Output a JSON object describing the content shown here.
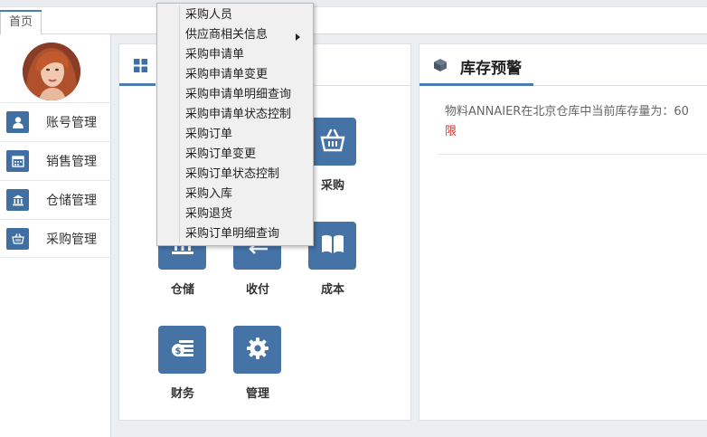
{
  "tabs": [
    {
      "label": "首页"
    }
  ],
  "sidebar": {
    "items": [
      {
        "label": "账号管理",
        "icon": "user-icon"
      },
      {
        "label": "销售管理",
        "icon": "calendar-icon"
      },
      {
        "label": "仓储管理",
        "icon": "bank-icon"
      },
      {
        "label": "采购管理",
        "icon": "basket-icon"
      }
    ]
  },
  "modules": {
    "purchase": "采购",
    "warehouse": "仓储",
    "payment": "收付",
    "cost": "成本",
    "finance": "财务",
    "manage": "管理"
  },
  "inventory": {
    "title": "库存预警",
    "message": "物料ANNAIER在北京仓库中当前库存量为：60",
    "message_tail": "限"
  },
  "context_menu": {
    "items": [
      "采购人员",
      "供应商相关信息",
      "采购申请单",
      "采购申请单变更",
      "采购申请单明细查询",
      "采购申请单状态控制",
      "采购订单",
      "采购订单变更",
      "采购订单状态控制",
      "采购入库",
      "采购退货",
      "采购订单明细查询"
    ]
  },
  "colors": {
    "accent": "#4a7db4",
    "tile": "#4573a6",
    "warning": "#d9362b"
  }
}
